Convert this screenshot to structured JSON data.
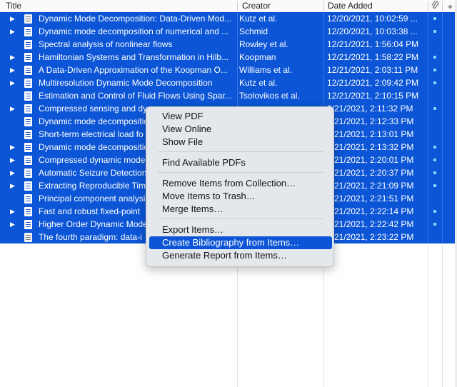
{
  "columns": {
    "title": "Title",
    "creator": "Creator",
    "date_added": "Date Added"
  },
  "header_icons": [
    "paperclip-icon",
    "unread-dot-icon"
  ],
  "colors": {
    "selection": "#0b55d6",
    "attachment_dot": "#7fe0ff"
  },
  "rows": [
    {
      "title": "Dynamic Mode Decomposition: Data-Driven Mod...",
      "creator": "Kutz et al.",
      "date": "12/20/2021, 10:02:59 ...",
      "twisty": true,
      "icon": "book-icon",
      "dot": true
    },
    {
      "title": "Dynamic mode decomposition of numerical and ...",
      "creator": "Schmid",
      "date": "12/20/2021, 10:03:38 ...",
      "twisty": true,
      "icon": "document-icon",
      "dot": true
    },
    {
      "title": "Spectral analysis of nonlinear flows",
      "creator": "Rowley et al.",
      "date": "12/21/2021, 1:56:04 PM",
      "twisty": false,
      "icon": "document-icon",
      "dot": false
    },
    {
      "title": "Hamiltonian Systems and Transformation in Hilb...",
      "creator": "Koopman",
      "date": "12/21/2021, 1:58:22 PM",
      "twisty": true,
      "icon": "document-icon",
      "dot": true
    },
    {
      "title": "A Data-Driven Approximation of the Koopman O...",
      "creator": "Williams et al.",
      "date": "12/21/2021, 2:03:11 PM",
      "twisty": true,
      "icon": "document-icon",
      "dot": true
    },
    {
      "title": "Multiresolution Dynamic Mode Decomposition",
      "creator": "Kutz et al.",
      "date": "12/21/2021, 2:09:42 PM",
      "twisty": true,
      "icon": "document-icon",
      "dot": true
    },
    {
      "title": "Estimation and Control of Fluid Flows Using Spar...",
      "creator": "Tsolovikos et al.",
      "date": "12/21/2021, 2:10:15 PM",
      "twisty": false,
      "icon": "document-icon",
      "dot": false
    },
    {
      "title": "Compressed sensing and dy",
      "creator": "",
      "date": "2/21/2021, 2:11:32 PM",
      "twisty": true,
      "icon": "document-icon",
      "dot": true
    },
    {
      "title": "Dynamic mode decompositio",
      "creator": "",
      "date": "2/21/2021, 2:12:33 PM",
      "twisty": false,
      "icon": "document-icon",
      "dot": false
    },
    {
      "title": "Short-term electrical load fo",
      "creator": "",
      "date": "2/21/2021, 2:13:01 PM",
      "twisty": false,
      "icon": "document-icon",
      "dot": false
    },
    {
      "title": "Dynamic mode decompositio",
      "creator": "",
      "date": "2/21/2021, 2:13:32 PM",
      "twisty": true,
      "icon": "document-icon",
      "dot": true
    },
    {
      "title": "Compressed dynamic mode",
      "creator": "",
      "date": "2/21/2021, 2:20:01 PM",
      "twisty": true,
      "icon": "document-icon",
      "dot": true
    },
    {
      "title": "Automatic Seizure Detection",
      "creator": "",
      "date": "2/21/2021, 2:20:37 PM",
      "twisty": true,
      "icon": "document-icon",
      "dot": true
    },
    {
      "title": "Extracting Reproducible Tim",
      "creator": "",
      "date": "2/21/2021, 2:21:09 PM",
      "twisty": true,
      "icon": "document-icon",
      "dot": true
    },
    {
      "title": "Principal component analysis",
      "creator": "",
      "date": "2/21/2021, 2:21:51 PM",
      "twisty": false,
      "icon": "document-icon",
      "dot": false
    },
    {
      "title": "Fast and robust fixed-point",
      "creator": "",
      "date": "2/21/2021, 2:22:14 PM",
      "twisty": true,
      "icon": "document-icon",
      "dot": true
    },
    {
      "title": "Higher Order Dynamic Mode",
      "creator": "",
      "date": "2/21/2021, 2:22:42 PM",
      "twisty": true,
      "icon": "document-icon",
      "dot": true
    },
    {
      "title": "The fourth paradigm: data-i",
      "creator": "",
      "date": "2/21/2021, 2:23:22 PM",
      "twisty": false,
      "icon": "book-icon",
      "dot": false
    }
  ],
  "context_menu": {
    "groups": [
      [
        "View PDF",
        "View Online",
        "Show File"
      ],
      [
        "Find Available PDFs"
      ],
      [
        "Remove Items from Collection…",
        "Move Items to Trash…",
        "Merge Items…"
      ],
      [
        "Export Items…",
        "Create Bibliography from Items…",
        "Generate Report from Items…"
      ]
    ],
    "highlighted": "Create Bibliography from Items…"
  }
}
